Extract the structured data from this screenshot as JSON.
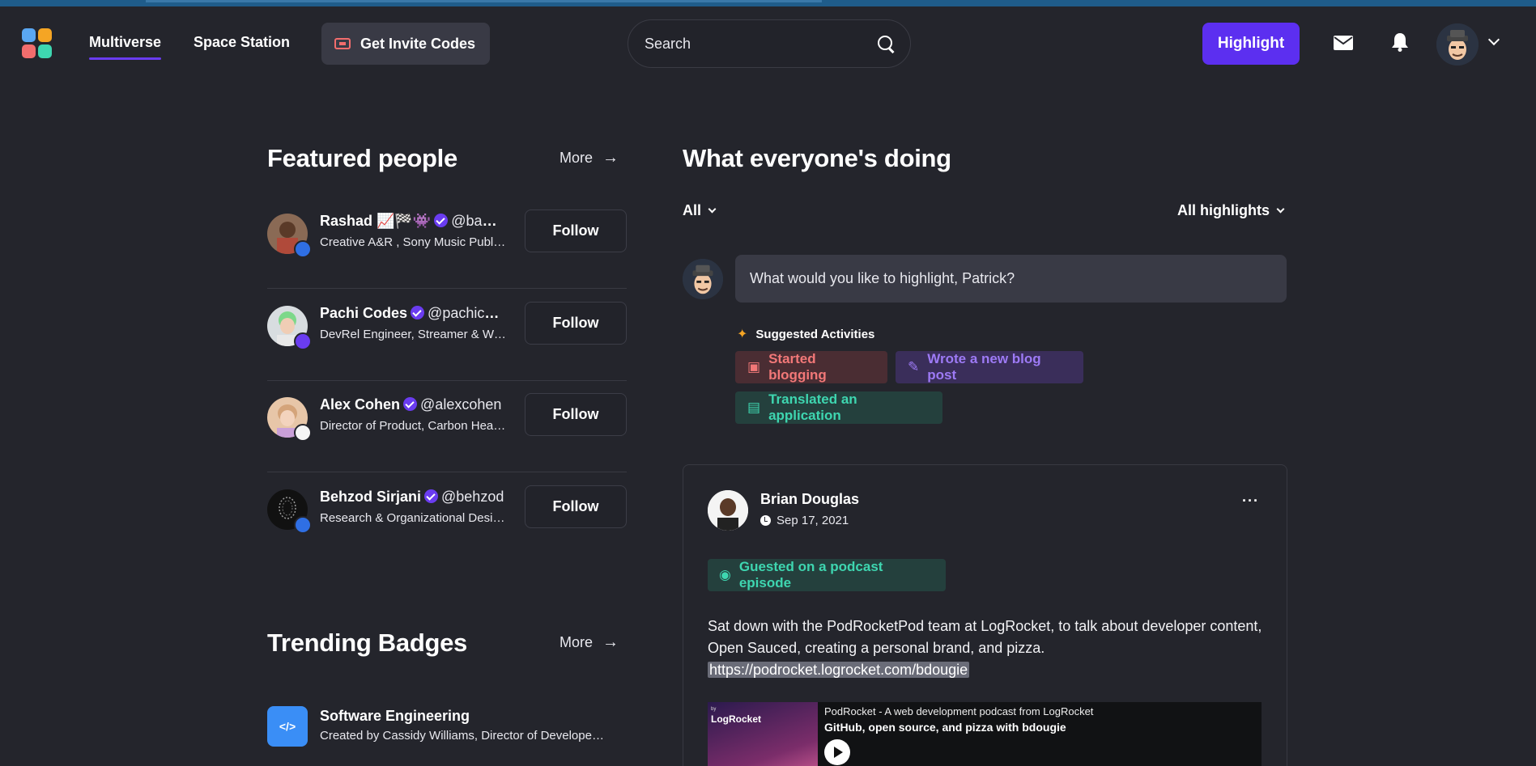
{
  "nav": {
    "links": [
      "Multiverse",
      "Space Station"
    ],
    "invite_label": "Get Invite Codes",
    "search_placeholder": "Search",
    "highlight_label": "Highlight"
  },
  "featured": {
    "title": "Featured people",
    "more_label": "More",
    "people": [
      {
        "name": "Rashad 📈🏁👾",
        "handle": "@babyrasta",
        "bio": "Creative A&R , Sony Music Publishing",
        "follow": "Follow"
      },
      {
        "name": "Pachi Codes",
        "handle": "@pachicodes",
        "bio": "DevRel Engineer, Streamer & Writer",
        "follow": "Follow"
      },
      {
        "name": "Alex Cohen",
        "handle": "@alexcohen",
        "bio": "Director of Product, Carbon Health",
        "follow": "Follow"
      },
      {
        "name": "Behzod Sirjani",
        "handle": "@behzod",
        "bio": "Research & Organizational Design",
        "follow": "Follow"
      }
    ]
  },
  "trending": {
    "title": "Trending Badges",
    "more_label": "More",
    "badge": {
      "icon_text": "</>",
      "title": "Software Engineering",
      "sub": "Created by Cassidy Williams, Director of Developer Experience"
    }
  },
  "feed": {
    "title": "What everyone's doing",
    "filter_left": "All",
    "filter_right": "All highlights",
    "compose_placeholder": "What would you like to highlight, Patrick?",
    "suggested_title": "Suggested Activities",
    "chips": [
      "Started blogging",
      "Wrote a new blog post",
      "Translated an application"
    ],
    "post": {
      "author": "Brian Douglas",
      "date": "Sep 17, 2021",
      "more": "···",
      "tag": "Guested on a podcast episode",
      "text": "Sat down with the PodRocketPod team at LogRocket, to talk about developer content, Open Sauced, creating a personal brand, and pizza.",
      "link": "https://podrocket.logrocket.com/bdougie",
      "embed_brand_small": "by",
      "embed_brand": "LogRocket",
      "embed_title": "PodRocket - A web development podcast from LogRocket",
      "embed_episode": "GitHub, open source, and pizza with bdougie"
    }
  },
  "colors": {
    "accent": "#5c2ff0",
    "background": "#24252c",
    "green": "#3ed6b0",
    "red": "#f27878",
    "purple": "#9d7af5"
  }
}
